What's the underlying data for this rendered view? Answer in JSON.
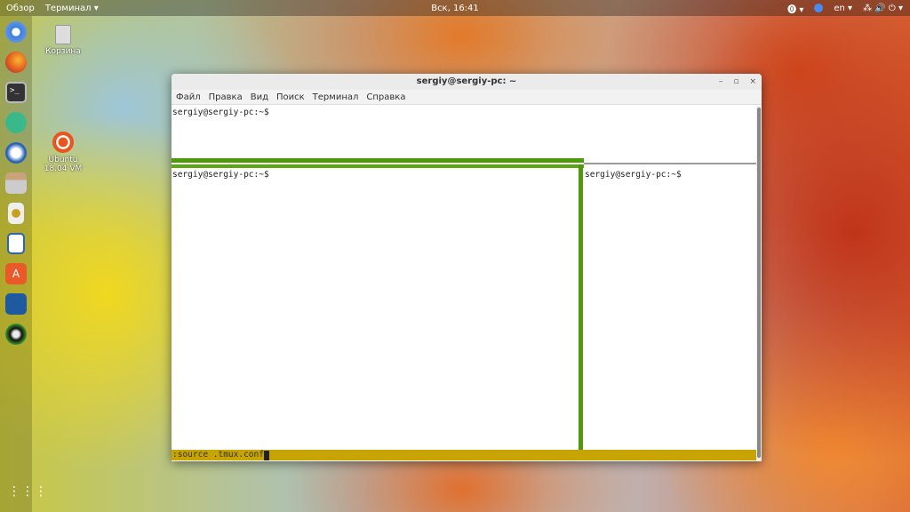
{
  "topbar": {
    "overview": "Обзор",
    "app": "Терминал ▾",
    "clock": "Вск, 16:41",
    "lang": "en ▾",
    "accessibility": "⓿ ▾",
    "status_icons": "⁂ 🔊 ⏻ ▾"
  },
  "desktop": {
    "trash": "Корзина",
    "ubuntu": "Ubuntu 18.04 VM"
  },
  "window": {
    "title": "sergiy@sergiy-pc: ~",
    "minimize": "–",
    "maximize": "▫",
    "close": "×",
    "menu": [
      "Файл",
      "Правка",
      "Вид",
      "Поиск",
      "Терминал",
      "Справка"
    ]
  },
  "panes": {
    "top": "sergiy@sergiy-pc:~$",
    "bottom_left": "sergiy@sergiy-pc:~$",
    "bottom_right": "sergiy@sergiy-pc:~$"
  },
  "status_bar": {
    "command": ":source .tmux.conf"
  },
  "colors": {
    "tmux_green": "#4f9a0a",
    "status_yellow": "#c8a400"
  }
}
